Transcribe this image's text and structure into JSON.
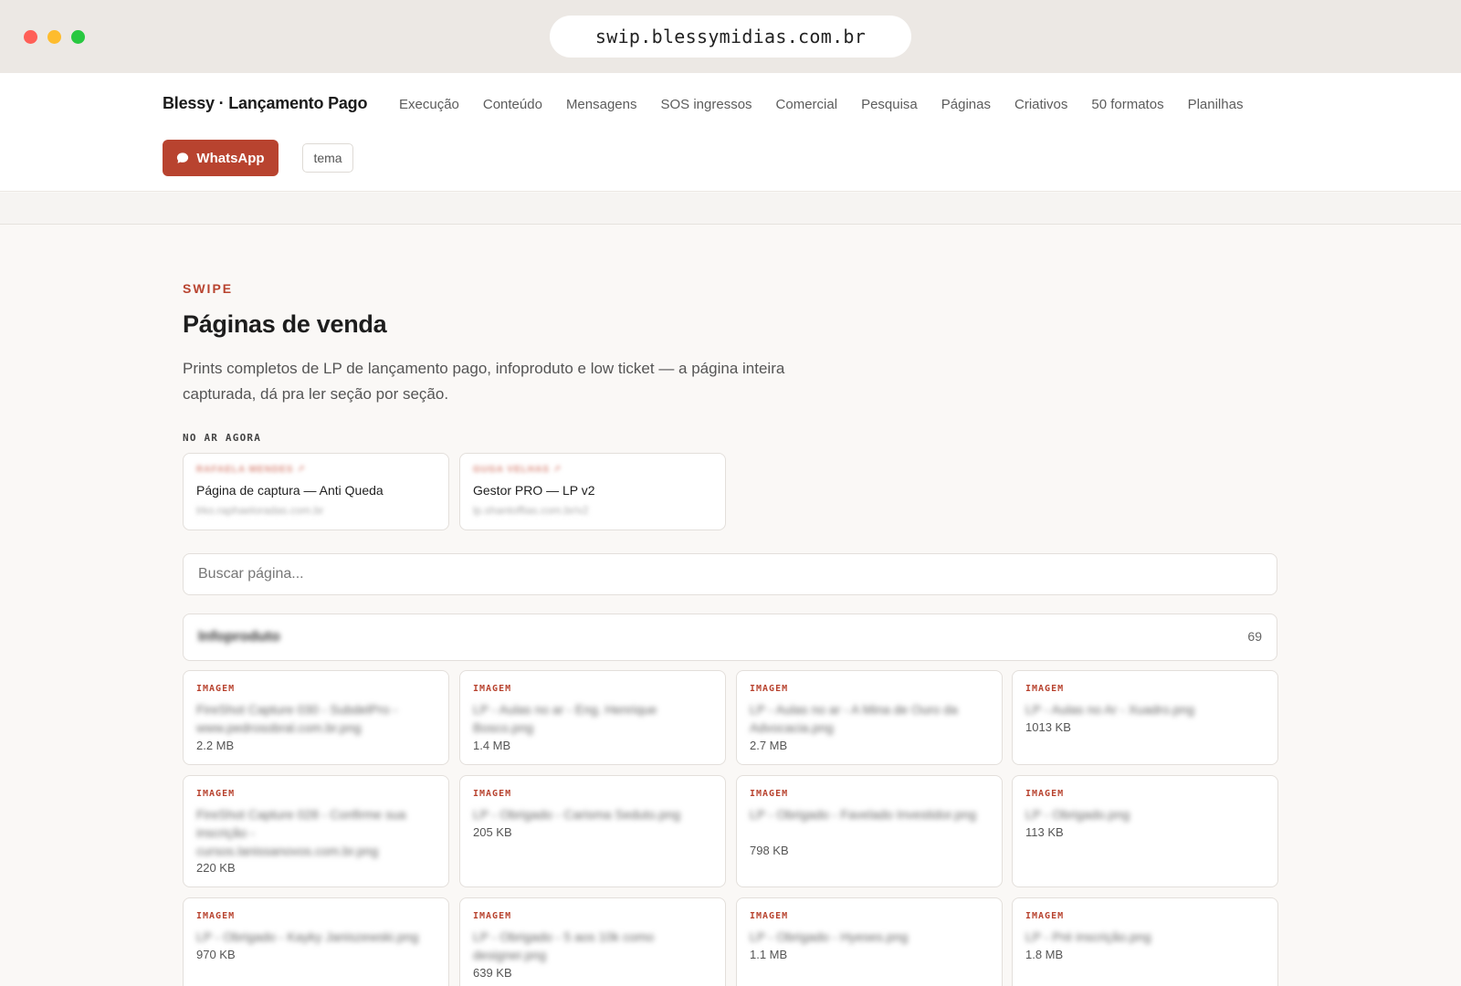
{
  "browser": {
    "url": "swip.blessymidias.com.br"
  },
  "header": {
    "brand": "Blessy · Lançamento Pago",
    "nav": [
      "Execução",
      "Conteúdo",
      "Mensagens",
      "SOS ingressos",
      "Comercial",
      "Pesquisa",
      "Páginas",
      "Criativos",
      "50 formatos",
      "Planilhas"
    ],
    "whatsapp_label": "WhatsApp",
    "tema_label": "tema"
  },
  "main": {
    "eyebrow": "SWIPE",
    "title": "Páginas de venda",
    "description": "Prints completos de LP de lançamento pago, infoproduto e low ticket — a página inteira capturada, dá pra ler seção por seção.",
    "live_label": "NO AR AGORA",
    "live": [
      {
        "tag": "RAFAELA MENDES ↗",
        "name": "Página de captura — Anti Queda",
        "url": "lrko.raphaeloradas.com.br"
      },
      {
        "tag": "GUGA VELHAS ↗",
        "name": "Gestor PRO — LP v2",
        "url": "lp.shantoffias.com.br/v2"
      }
    ],
    "search_placeholder": "Buscar página...",
    "group": {
      "name": "Infoproduto",
      "count": "69"
    },
    "items": [
      {
        "kind": "IMAGEM",
        "name": "FireShot Capture 030 - SubdelPro - www.pedrosobral.com.br.png",
        "size": "2.2 MB"
      },
      {
        "kind": "IMAGEM",
        "name": "LP - Aulas no ar - Eng. Henrique Bosco.png",
        "size": "1.4 MB"
      },
      {
        "kind": "IMAGEM",
        "name": "LP - Aulas no ar - A Mina de Ouro da Advocacia.png",
        "size": "2.7 MB"
      },
      {
        "kind": "IMAGEM",
        "name": "LP - Aulas no Ar - Xuadro.png",
        "size": "1013 KB"
      },
      {
        "kind": "IMAGEM",
        "name": "FireShot Capture 028 - Confirme sua inscrição - cursos.lanissanovos.com.br.png",
        "size": "220 KB"
      },
      {
        "kind": "IMAGEM",
        "name": "LP - Obrigado - Carisma Seduto.png",
        "size": "205 KB"
      },
      {
        "kind": "IMAGEM",
        "name": "LP - Obrigado - Favelado Investidor.png",
        "size": "798 KB"
      },
      {
        "kind": "IMAGEM",
        "name": "LP - Obrigado.png",
        "size": "113 KB"
      },
      {
        "kind": "IMAGEM",
        "name": "LP - Obrigado - Kayky Janiszewski.png",
        "size": "970 KB"
      },
      {
        "kind": "IMAGEM",
        "name": "LP - Obrigado - 5 aos 10k como designer.png",
        "size": "639 KB"
      },
      {
        "kind": "IMAGEM",
        "name": "LP - Obrigado - Hyeses.png",
        "size": "1.1 MB"
      },
      {
        "kind": "IMAGEM",
        "name": "LP - Pré inscrição.png",
        "size": "1.8 MB"
      }
    ]
  }
}
